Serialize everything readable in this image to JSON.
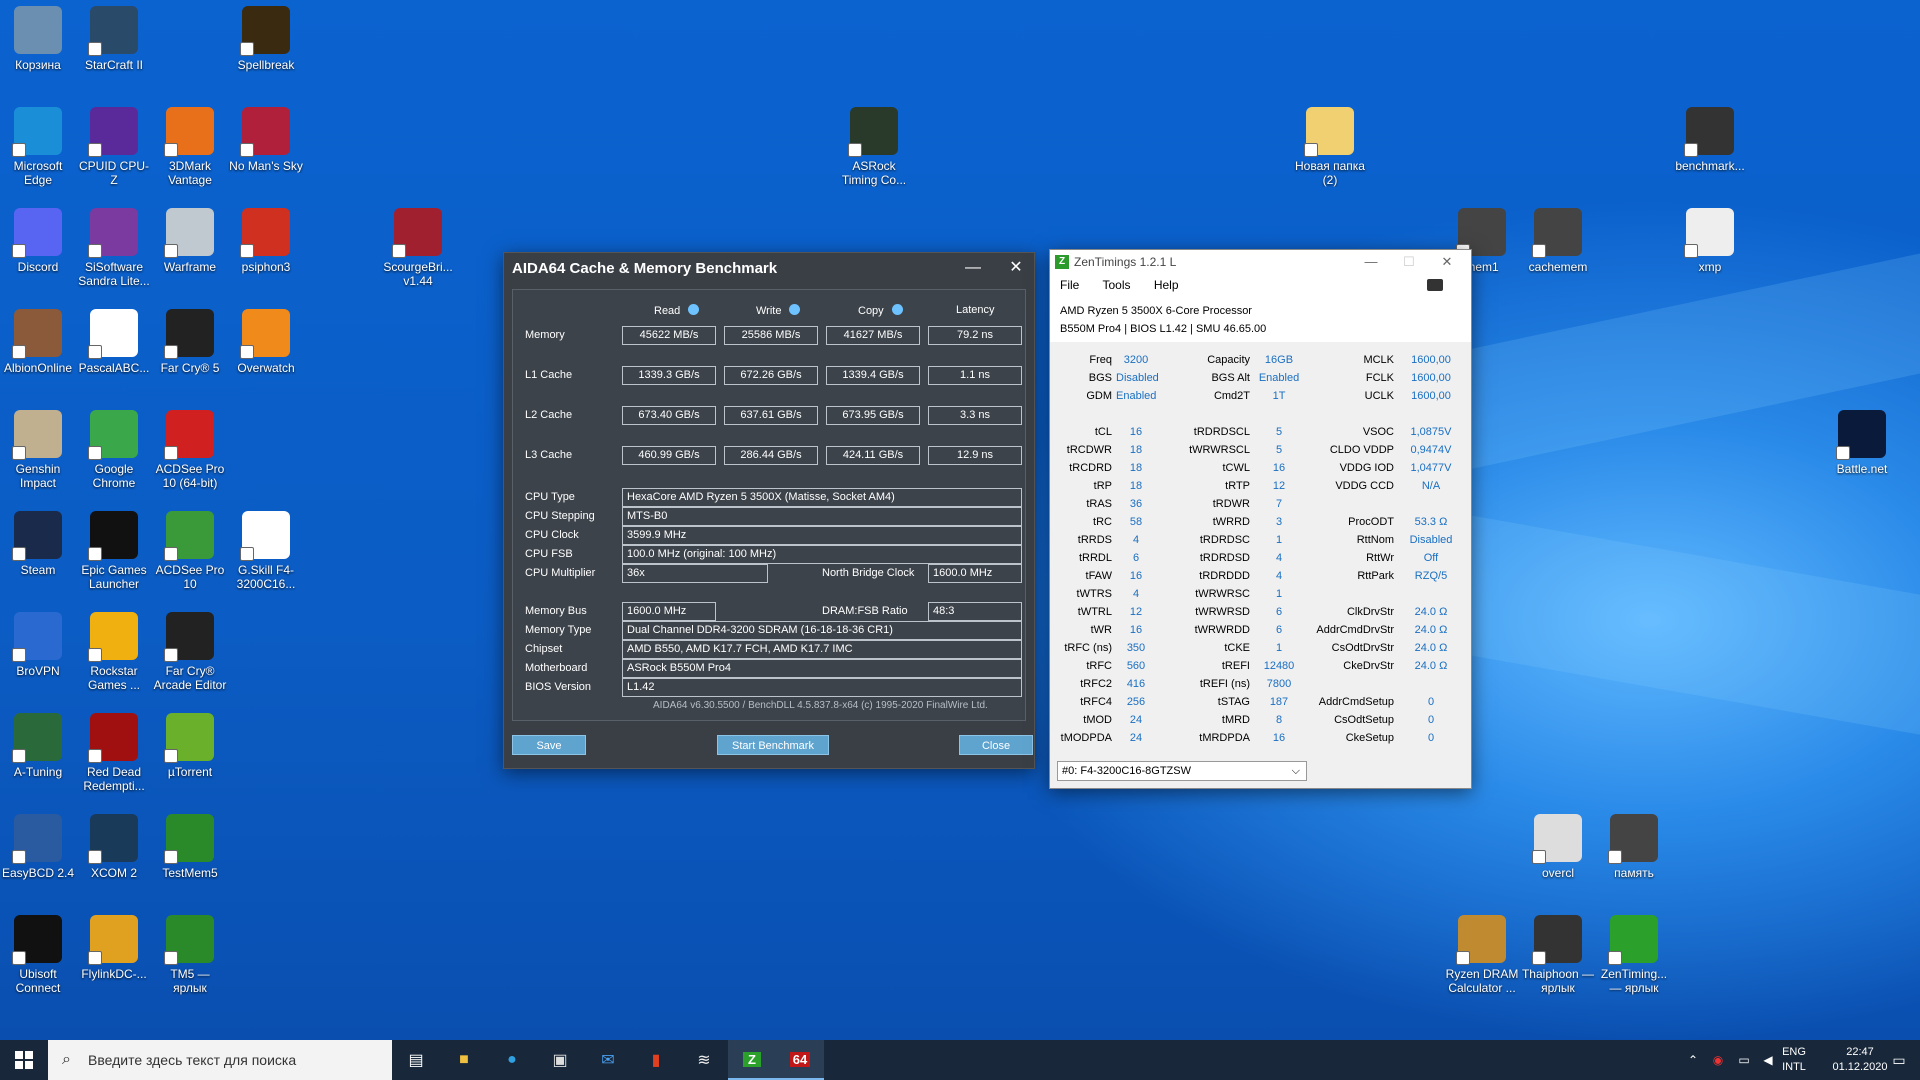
{
  "desktop_icons": [
    {
      "label": "Корзина",
      "icon": "recycle-bin-icon",
      "color": "#6a8fb0"
    },
    {
      "label": "StarCraft II",
      "icon": "starcraft-icon",
      "color": "#2a4a6a"
    },
    {
      "label": "Spellbreak",
      "icon": "spellbreak-icon",
      "color": "#3a2a10"
    },
    {
      "label": "Microsoft Edge",
      "icon": "edge-icon",
      "color": "#1a8fd8"
    },
    {
      "label": "CPUID CPU-Z",
      "icon": "cpuz-icon",
      "color": "#5a2a9a"
    },
    {
      "label": "3DMark Vantage",
      "icon": "3dmark-icon",
      "color": "#e8701a"
    },
    {
      "label": "No Man's Sky",
      "icon": "nomanssky-icon",
      "color": "#b0203a"
    },
    {
      "label": "ASRock Timing Co...",
      "icon": "asrock-timing-icon",
      "color": "#2a3a2a"
    },
    {
      "label": "Новая папка (2)",
      "icon": "folder-icon",
      "color": "#f0d070"
    },
    {
      "label": "benchmark...",
      "icon": "image-file-icon",
      "color": "#333"
    },
    {
      "label": "Discord",
      "icon": "discord-icon",
      "color": "#5865f2"
    },
    {
      "label": "SiSoftware Sandra Lite...",
      "icon": "sandra-icon",
      "color": "#7a3aa0"
    },
    {
      "label": "Warframe",
      "icon": "warframe-icon",
      "color": "#c0c8d0"
    },
    {
      "label": "psiphon3",
      "icon": "psiphon-icon",
      "color": "#d03020"
    },
    {
      "label": "ScourgeBri... v1.44",
      "icon": "scourgebringer-icon",
      "color": "#a02030"
    },
    {
      "label": "mem1",
      "icon": "image-file-icon",
      "color": "#444"
    },
    {
      "label": "cachemem",
      "icon": "image-file-icon",
      "color": "#444"
    },
    {
      "label": "xmp",
      "icon": "image-file-icon",
      "color": "#eee"
    },
    {
      "label": "AlbionOnline",
      "icon": "albion-icon",
      "color": "#8a5a3a"
    },
    {
      "label": "PascalABC...",
      "icon": "pascalabc-icon",
      "color": "#fff"
    },
    {
      "label": "Far Cry® 5",
      "icon": "farcry5-icon",
      "color": "#222"
    },
    {
      "label": "Overwatch",
      "icon": "overwatch-icon",
      "color": "#f08a1a"
    },
    {
      "label": "Battle.net",
      "icon": "battlenet-icon",
      "color": "#0a1a3a"
    },
    {
      "label": "Genshin Impact",
      "icon": "genshin-icon",
      "color": "#c0b090"
    },
    {
      "label": "Google Chrome",
      "icon": "chrome-icon",
      "color": "#3aa84a"
    },
    {
      "label": "ACDSee Pro 10 (64-bit)",
      "icon": "acdsee-icon",
      "color": "#d02020"
    },
    {
      "label": "Steam",
      "icon": "steam-icon",
      "color": "#1a2a4a"
    },
    {
      "label": "Epic Games Launcher",
      "icon": "epic-icon",
      "color": "#111"
    },
    {
      "label": "ACDSee Pro 10",
      "icon": "acdsee-new-icon",
      "color": "#3a9a3a"
    },
    {
      "label": "G.Skill F4-3200C16...",
      "icon": "text-file-icon",
      "color": "#fff"
    },
    {
      "label": "BroVPN",
      "icon": "brovpn-icon",
      "color": "#2a6ad0"
    },
    {
      "label": "Rockstar Games ...",
      "icon": "rockstar-icon",
      "color": "#f0b010"
    },
    {
      "label": "Far Cry® Arcade Editor",
      "icon": "farcry-arcade-icon",
      "color": "#222"
    },
    {
      "label": "A-Tuning",
      "icon": "atuning-icon",
      "color": "#2a6a3a"
    },
    {
      "label": "Red Dead Redempti...",
      "icon": "rdr-icon",
      "color": "#a01010"
    },
    {
      "label": "µTorrent",
      "icon": "utorrent-icon",
      "color": "#6ab02a"
    },
    {
      "label": "overcl",
      "icon": "image-file-icon",
      "color": "#ddd"
    },
    {
      "label": "память",
      "icon": "image-file-icon",
      "color": "#444"
    },
    {
      "label": "EasyBCD 2.4",
      "icon": "easybcd-icon",
      "color": "#2a5aa0"
    },
    {
      "label": "XCOM 2",
      "icon": "xcom-icon",
      "color": "#1a3a5a"
    },
    {
      "label": "TestMem5",
      "icon": "testmem-icon",
      "color": "#2a8a2a"
    },
    {
      "label": "Ubisoft Connect",
      "icon": "ubisoft-icon",
      "color": "#111"
    },
    {
      "label": "FlylinkDC-...",
      "icon": "flylink-icon",
      "color": "#e0a020"
    },
    {
      "label": "TM5 — ярлык",
      "icon": "testmem-icon",
      "color": "#2a8a2a"
    },
    {
      "label": "Ryzen DRAM Calculator ...",
      "icon": "dram-calc-icon",
      "color": "#c08a30"
    },
    {
      "label": "Thaiphoon — ярлык",
      "icon": "thaiphoon-icon",
      "color": "#333"
    },
    {
      "label": "ZenTiming... — ярлык",
      "icon": "zentimings-icon",
      "color": "#2ba02b"
    }
  ],
  "aida": {
    "title": "AIDA64 Cache & Memory Benchmark",
    "minimize": "—",
    "close": "✕",
    "headers": [
      "Read",
      "Write",
      "Copy",
      "Latency"
    ],
    "rows": [
      {
        "label": "Memory",
        "values": [
          "45622 MB/s",
          "25586 MB/s",
          "41627 MB/s",
          "79.2 ns"
        ]
      },
      {
        "label": "L1 Cache",
        "values": [
          "1339.3 GB/s",
          "672.26 GB/s",
          "1339.4 GB/s",
          "1.1 ns"
        ]
      },
      {
        "label": "L2 Cache",
        "values": [
          "673.40 GB/s",
          "637.61 GB/s",
          "673.95 GB/s",
          "3.3 ns"
        ]
      },
      {
        "label": "L3 Cache",
        "values": [
          "460.99 GB/s",
          "286.44 GB/s",
          "424.11 GB/s",
          "12.9 ns"
        ]
      }
    ],
    "cpu_type_label": "CPU Type",
    "cpu_type": "HexaCore AMD Ryzen 5 3500X  (Matisse, Socket AM4)",
    "cpu_stepping_label": "CPU Stepping",
    "cpu_stepping": "MTS-B0",
    "cpu_clock_label": "CPU Clock",
    "cpu_clock": "3599.9 MHz",
    "cpu_fsb_label": "CPU FSB",
    "cpu_fsb": "100.0 MHz  (original: 100 MHz)",
    "cpu_mult_label": "CPU Multiplier",
    "cpu_mult": "36x",
    "nb_clock_label": "North Bridge Clock",
    "nb_clock": "1600.0 MHz",
    "mem_bus_label": "Memory Bus",
    "mem_bus": "1600.0 MHz",
    "dram_fsb_label": "DRAM:FSB Ratio",
    "dram_fsb": "48:3",
    "mem_type_label": "Memory Type",
    "mem_type": "Dual Channel DDR4-3200 SDRAM  (16-18-18-36 CR1)",
    "chipset_label": "Chipset",
    "chipset": "AMD B550, AMD K17.7 FCH, AMD K17.7 IMC",
    "mobo_label": "Motherboard",
    "mobo": "ASRock B550M Pro4",
    "bios_label": "BIOS Version",
    "bios": "L1.42",
    "footer": "AIDA64 v6.30.5500 / BenchDLL 4.5.837.8-x64  (c) 1995-2020 FinalWire Ltd.",
    "save": "Save",
    "start": "Start Benchmark",
    "close_btn": "Close"
  },
  "zen": {
    "title": "ZenTimings 1.2.1 L",
    "menu": [
      "File",
      "Tools",
      "Help"
    ],
    "cpu": "AMD Ryzen 5 3500X 6-Core Processor",
    "board": "B550M Pro4 | BIOS L1.42 | SMU 46.65.00",
    "rows": [
      [
        "Freq",
        "3200",
        "Capacity",
        "16GB",
        "MCLK",
        "1600,00"
      ],
      [
        "BGS",
        "Disabled",
        "BGS Alt",
        "Enabled",
        "FCLK",
        "1600,00"
      ],
      [
        "GDM",
        "Enabled",
        "Cmd2T",
        "1T",
        "UCLK",
        "1600,00"
      ],
      [
        "",
        "",
        "",
        "",
        "",
        ""
      ],
      [
        "tCL",
        "16",
        "tRDRDSCL",
        "5",
        "VSOC",
        "1,0875V"
      ],
      [
        "tRCDWR",
        "18",
        "tWRWRSCL",
        "5",
        "CLDO VDDP",
        "0,9474V"
      ],
      [
        "tRCDRD",
        "18",
        "tCWL",
        "16",
        "VDDG IOD",
        "1,0477V"
      ],
      [
        "tRP",
        "18",
        "tRTP",
        "12",
        "VDDG CCD",
        "N/A"
      ],
      [
        "tRAS",
        "36",
        "tRDWR",
        "7",
        "",
        ""
      ],
      [
        "tRC",
        "58",
        "tWRRD",
        "3",
        "ProcODT",
        "53.3 Ω"
      ],
      [
        "tRRDS",
        "4",
        "tRDRDSC",
        "1",
        "RttNom",
        "Disabled"
      ],
      [
        "tRRDL",
        "6",
        "tRDRDSD",
        "4",
        "RttWr",
        "Off"
      ],
      [
        "tFAW",
        "16",
        "tRDRDDD",
        "4",
        "RttPark",
        "RZQ/5"
      ],
      [
        "tWTRS",
        "4",
        "tWRWRSC",
        "1",
        "",
        ""
      ],
      [
        "tWTRL",
        "12",
        "tWRWRSD",
        "6",
        "ClkDrvStr",
        "24.0 Ω"
      ],
      [
        "tWR",
        "16",
        "tWRWRDD",
        "6",
        "AddrCmdDrvStr",
        "24.0 Ω"
      ],
      [
        "tRFC (ns)",
        "350",
        "tCKE",
        "1",
        "CsOdtDrvStr",
        "24.0 Ω"
      ],
      [
        "tRFC",
        "560",
        "tREFI",
        "12480",
        "CkeDrvStr",
        "24.0 Ω"
      ],
      [
        "tRFC2",
        "416",
        "tREFI (ns)",
        "7800",
        "",
        ""
      ],
      [
        "tRFC4",
        "256",
        "tSTAG",
        "187",
        "AddrCmdSetup",
        "0"
      ],
      [
        "tMOD",
        "24",
        "tMRD",
        "8",
        "CsOdtSetup",
        "0"
      ],
      [
        "tMODPDA",
        "24",
        "tMRDPDA",
        "16",
        "CkeSetup",
        "0"
      ]
    ],
    "module": "#0: F4-3200C16-8GTZSW"
  },
  "taskbar": {
    "search_placeholder": "Введите здесь текст для поиска",
    "lang": "ENG",
    "layout": "INTL",
    "time": "22:47",
    "date": "01.12.2020"
  }
}
